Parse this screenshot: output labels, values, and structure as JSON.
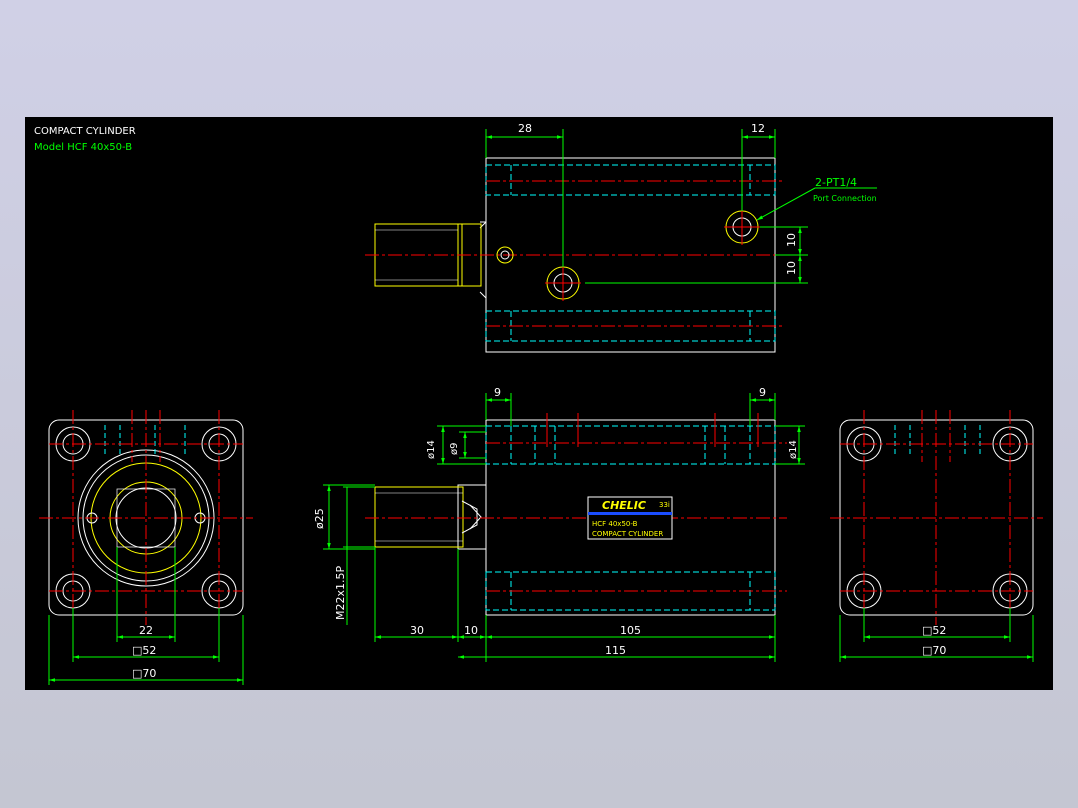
{
  "title_block": {
    "title": "COMPACT CYLINDER",
    "model_line": "Model  HCF 40x50-B"
  },
  "top_view": {
    "dim_left": "28",
    "dim_right": "12",
    "port_label": "2-PT1/4",
    "port_sub": "Port Connection",
    "dim_v1": "10",
    "dim_v2": "10"
  },
  "front_view": {
    "dim_left_top": "9",
    "dim_right_top": "9",
    "dia_14_left": "ø14",
    "dia_9": "ø9",
    "dia_14_right": "ø14",
    "dia_25": "ø25",
    "thread": "M22x1.5P",
    "dim_30": "30",
    "dim_10": "10",
    "dim_105": "105",
    "dim_115": "115"
  },
  "nameplate": {
    "brand": "CHELIC",
    "code": "33i",
    "model": "HCF 40x50-B",
    "desc": "COMPACT CYLINDER"
  },
  "left_view": {
    "dim_22": "22",
    "dim_52": "□52",
    "dim_70": "□70"
  },
  "right_view": {
    "dim_52": "□52",
    "dim_70": "□70"
  },
  "colors": {
    "outline": "#ffffff",
    "hidden": "#00ffff",
    "center": "#ff0000",
    "dimension": "#00ff00",
    "highlight": "#ffff00"
  }
}
